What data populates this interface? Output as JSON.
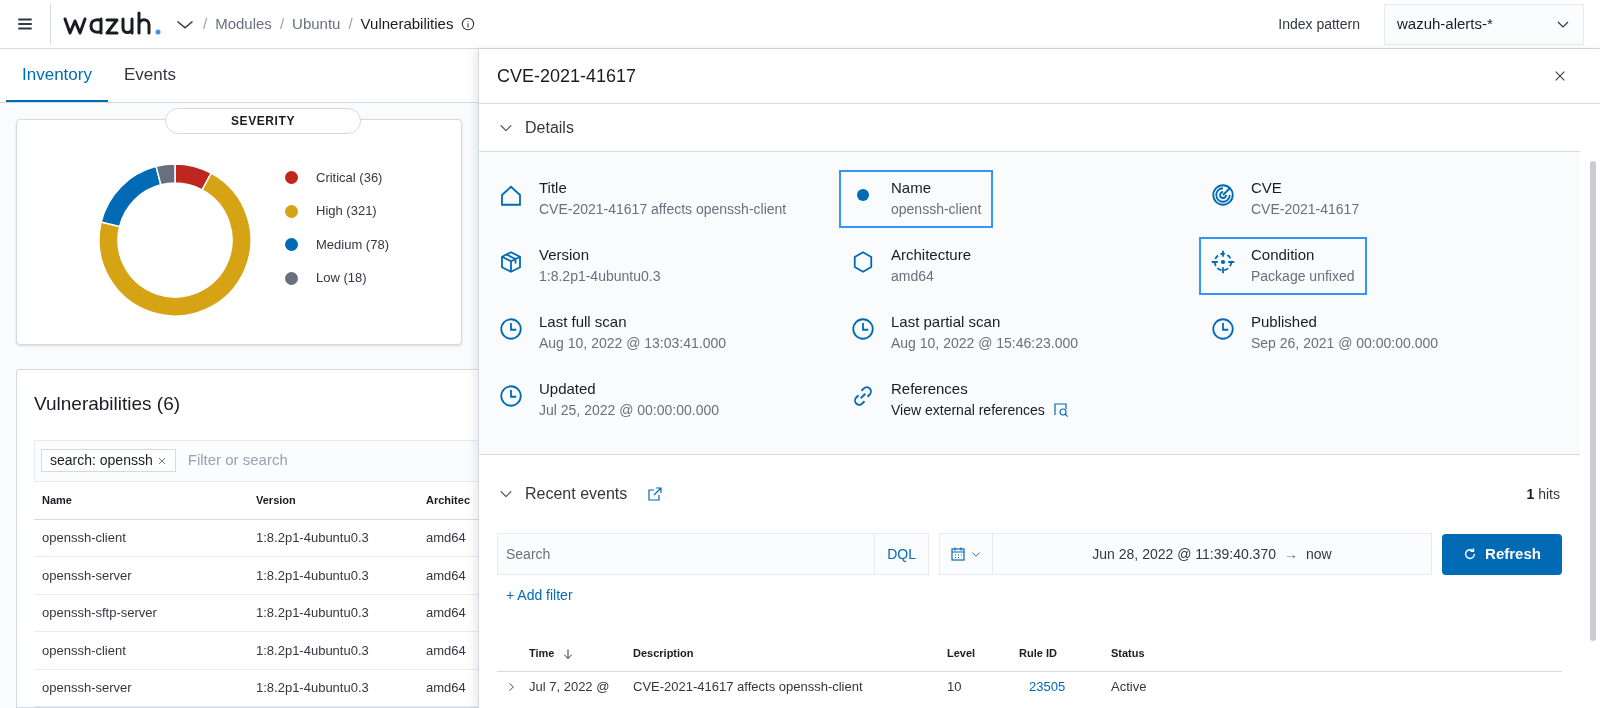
{
  "header": {
    "separator": "/",
    "breadcrumbs": [
      {
        "label": "Modules",
        "current": false
      },
      {
        "label": "Ubuntu",
        "current": false
      },
      {
        "label": "Vulnerabilities",
        "current": true
      }
    ],
    "index_pattern": {
      "label": "Index pattern",
      "value": "wazuh-alerts-*"
    }
  },
  "tabs": [
    {
      "label": "Inventory",
      "selected": true
    },
    {
      "label": "Events",
      "selected": false
    }
  ],
  "severity": {
    "title": "SEVERITY",
    "legend": [
      {
        "label": "Critical (36)",
        "color": "#bd271e"
      },
      {
        "label": "High (321)",
        "color": "#d6a314"
      },
      {
        "label": "Medium (78)",
        "color": "#006bb4"
      },
      {
        "label": "Low (18)",
        "color": "#69707d"
      }
    ],
    "chart_data": {
      "type": "donut",
      "values": [
        7.9,
        70.9,
        17.2,
        4.0
      ]
    }
  },
  "vulnerabilities": {
    "title": "Vulnerabilities (6)",
    "filter_chip": "search: openssh",
    "placeholder": "Filter or search",
    "columns": [
      "Name",
      "Version",
      "Architec"
    ],
    "rows": [
      [
        "openssh-client",
        "1:8.2p1-4ubuntu0.3",
        "amd64"
      ],
      [
        "openssh-server",
        "1:8.2p1-4ubuntu0.3",
        "amd64"
      ],
      [
        "openssh-sftp-server",
        "1:8.2p1-4ubuntu0.3",
        "amd64"
      ],
      [
        "openssh-client",
        "1:8.2p1-4ubuntu0.3",
        "amd64"
      ],
      [
        "openssh-server",
        "1:8.2p1-4ubuntu0.3",
        "amd64"
      ]
    ]
  },
  "flyout": {
    "title": "CVE-2021-41617",
    "details_label": "Details",
    "fields": [
      {
        "kind": "title",
        "label": "Title",
        "value": "CVE-2021-41617 affects openssh-client",
        "highlighted": false
      },
      {
        "kind": "name",
        "label": "Name",
        "value": "openssh-client",
        "highlighted": true
      },
      {
        "kind": "cve",
        "label": "CVE",
        "value": "CVE-2021-41617",
        "highlighted": false
      },
      {
        "kind": "version",
        "label": "Version",
        "value": "1:8.2p1-4ubuntu0.3",
        "highlighted": false
      },
      {
        "kind": "architecture",
        "label": "Architecture",
        "value": "amd64",
        "highlighted": false
      },
      {
        "kind": "condition",
        "label": "Condition",
        "value": "Package unfixed",
        "highlighted": true
      },
      {
        "kind": "time",
        "label": "Last full scan",
        "value": "Aug 10, 2022 @ 13:03:41.000",
        "highlighted": false
      },
      {
        "kind": "time",
        "label": "Last partial scan",
        "value": "Aug 10, 2022 @ 15:46:23.000",
        "highlighted": false
      },
      {
        "kind": "time",
        "label": "Published",
        "value": "Sep 26, 2021 @ 00:00:00.000",
        "highlighted": false
      },
      {
        "kind": "time",
        "label": "Updated",
        "value": "Jul 25, 2022 @ 00:00:00.000",
        "highlighted": false
      },
      {
        "kind": "link",
        "label": "References",
        "value": "View external references",
        "highlighted": false
      }
    ],
    "recent_events": {
      "label": "Recent events",
      "hits_count": "1",
      "hits_label": "hits",
      "search_placeholder": "Search",
      "query_language": "DQL",
      "time_range": "Jun 28, 2022 @ 11:39:40.370",
      "arrow": "→",
      "time_end": "now",
      "refresh": "Refresh",
      "add_filter": "+ Add filter",
      "columns": [
        "Time",
        "Description",
        "Level",
        "Rule ID",
        "Status"
      ],
      "rows": [
        {
          "time": "Jul 7, 2022 @",
          "description": "CVE-2021-41617 affects openssh-client",
          "level": "10",
          "rule_id": "23505",
          "status": "Active"
        }
      ]
    }
  }
}
